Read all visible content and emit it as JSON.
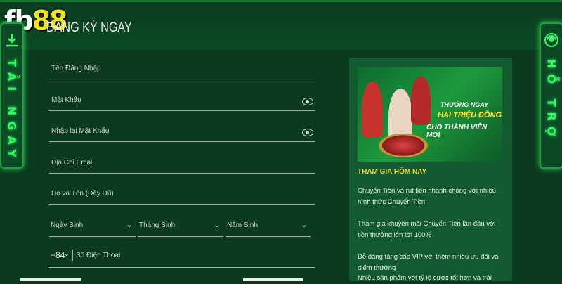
{
  "header": {
    "logo_text_a": "fb",
    "logo_text_b": "88",
    "page_title": "ĐĂNG KÝ NGAY"
  },
  "side_left": {
    "icon": "download-icon",
    "label": "TẢI NGAY"
  },
  "side_right": {
    "icon": "support-agent-icon",
    "label": "HỖ TRỢ"
  },
  "form": {
    "username": "Tên Đăng Nhập",
    "password": "Mật Khẩu",
    "password_confirm": "Nhập lại Mật Khẩu",
    "email": "Địa Chỉ Email",
    "fullname": "Họ và Tên (Đầy Đủ)",
    "dob_day": "Ngày Sinh",
    "dob_month": "Tháng Sinh",
    "dob_year": "Năm Sinh",
    "phone_code": "+84",
    "phone": "Số Điện Thoại"
  },
  "promo": {
    "banner_line1": "THƯỞNG NGAY",
    "banner_line2": "HAI TRIỆU ĐỒNG",
    "banner_line3": "CHO THÀNH VIÊN MỚI",
    "heading": "THAM GIA HÔM NAY",
    "text1": "Chuyển Tiền và rút tiền nhanh chóng với nhiều hình thức Chuyển Tiền",
    "text2": "Tham gia khuyến mãi Chuyển Tiền lần đầu với tiền thưởng lên tới 100%",
    "text3": "Dễ dàng tăng cấp VIP với thêm nhiều ưu đãi và điểm thưởng",
    "text4": "Nhiều sản phẩm với tỷ lệ cược tốt hơn và trải"
  },
  "colors": {
    "background": "#0b3a1e",
    "accent_green": "#3ff36a",
    "heading_yellow": "#f2d02a"
  }
}
